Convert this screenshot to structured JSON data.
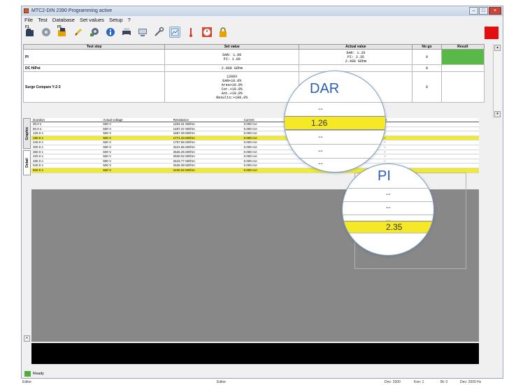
{
  "window": {
    "title": "MTC2-DIN 2390 Programming active",
    "min": "–",
    "max": "□",
    "close": "×"
  },
  "menu": [
    "File",
    "Test",
    "Database",
    "Set values",
    "Setup",
    "?"
  ],
  "toolbar": [
    {
      "icon": "open-file-icon",
      "label": "F1"
    },
    {
      "icon": "disc-icon",
      "label": ""
    },
    {
      "icon": "save-icon",
      "label": "F5"
    },
    {
      "icon": "pencil-icon",
      "label": ""
    },
    {
      "icon": "settings-icon",
      "label": ""
    },
    {
      "icon": "info-icon",
      "label": ""
    },
    {
      "icon": "print-icon",
      "label": ""
    },
    {
      "icon": "monitor-icon",
      "label": ""
    },
    {
      "icon": "wrench-icon",
      "label": ""
    },
    {
      "icon": "chart-icon",
      "label": ""
    },
    {
      "icon": "measure-icon",
      "label": ""
    },
    {
      "icon": "stopwatch-icon",
      "label": ""
    },
    {
      "icon": "lock-icon",
      "label": ""
    }
  ],
  "colors": {
    "accent_red": "#e01010",
    "pass_green": "#58b848",
    "highlight_yellow": "#f2ea2c",
    "zoom_blue": "#2a5db8"
  },
  "steps_table": {
    "headers": [
      "Test step",
      "Set value",
      "Actual value",
      "No go",
      "Result"
    ],
    "rows": [
      {
        "step": "PI",
        "set": [
          "DAR: 1.00",
          "PI: 1.00"
        ],
        "actual": [
          "DAR: 1.26",
          "PI: 2.35",
          "2.400 GOhm"
        ],
        "nogo": "0",
        "result": ""
      },
      {
        "step": "DC HiPot",
        "set": [
          "2.000 GOhm"
        ],
        "actual": [],
        "nogo": "0",
        "result": ""
      },
      {
        "step": "Surge Compare Y-2-3",
        "set": [
          "1200V",
          "EAR+10.0%",
          "Area+10.0%",
          "Cor.+10.0%",
          "Ant.+10.0%",
          "Results:+100.0%"
        ],
        "actual": [],
        "nogo": "0",
        "result": ""
      }
    ]
  },
  "side_tabs": [
    "Graphic",
    "Detail"
  ],
  "measure_table": {
    "headers": [
      "Duration",
      "Actual voltage",
      "Resistance",
      "Current",
      "",
      "PI"
    ],
    "rows": [
      [
        "30.0 s",
        "500 V",
        "1204.31 MOhm",
        "0.000 mA",
        "",
        "--"
      ],
      [
        "60.0 s",
        "500 V",
        "1407.37 MOhm",
        "0.000 mA",
        "",
        "--"
      ],
      [
        "120.0 s",
        "500 V",
        "1687.29 MOhm",
        "0.000 mA",
        "",
        "--"
      ],
      [
        "180.0 s",
        "500 V",
        "1771.34 MOhm",
        "0.000 mA",
        "",
        "--"
      ],
      [
        "240.0 s",
        "500 V",
        "1757.65 MOhm",
        "0.000 mA",
        "",
        "--"
      ],
      [
        "300.0 s",
        "500 V",
        "2421.65 MOhm",
        "0.000 mA",
        "",
        "--"
      ],
      [
        "360.0 s",
        "500 V",
        "2626.25 MOhm",
        "0.000 mA",
        "",
        "--"
      ],
      [
        "420.0 s",
        "500 V",
        "2530.02 MOhm",
        "0.000 mA",
        "",
        "--"
      ],
      [
        "480.0 s",
        "500 V",
        "2543.77 MOhm",
        "0.000 mA",
        "",
        "--"
      ],
      [
        "540.0 s",
        "500 V",
        "2626.39 MOhm",
        "0.000 mA",
        "",
        "--"
      ],
      [
        "600.0 s",
        "500 V",
        "2430.02 MOhm",
        "0.000 mA",
        "",
        "--"
      ]
    ],
    "highlight_rows": [
      3,
      10
    ]
  },
  "zoom_dar": {
    "title": "DAR",
    "rows": [
      "--",
      "1.26",
      "--",
      "--",
      "--"
    ],
    "highlight": 1
  },
  "zoom_pi": {
    "title": "PI",
    "rows": [
      "--",
      "--",
      "--",
      "2.35"
    ],
    "highlight": 3
  },
  "status": {
    "text": "Ready"
  },
  "bottom_bar": {
    "left": "Editor",
    "center": "Editor",
    "right1": "Dev: 2500",
    "right2": "Kon: 1",
    "right3": "Bt: 0",
    "right4": "Dev: 2500 Hz"
  }
}
